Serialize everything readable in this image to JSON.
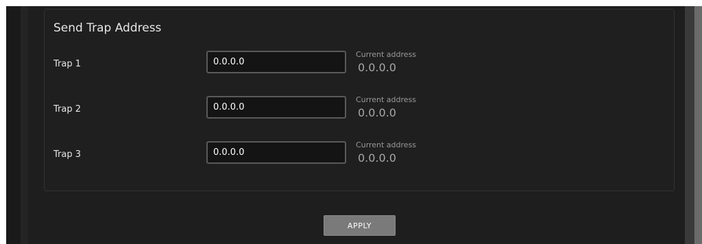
{
  "section": {
    "title": "Send Trap Address"
  },
  "traps": [
    {
      "label": "Trap 1",
      "value": "0.0.0.0",
      "current_caption": "Current address",
      "current_value": "0.0.0.0"
    },
    {
      "label": "Trap 2",
      "value": "0.0.0.0",
      "current_caption": "Current address",
      "current_value": "0.0.0.0"
    },
    {
      "label": "Trap 3",
      "value": "0.0.0.0",
      "current_caption": "Current address",
      "current_value": "0.0.0.0"
    }
  ],
  "actions": {
    "apply_label": "APPLY"
  }
}
